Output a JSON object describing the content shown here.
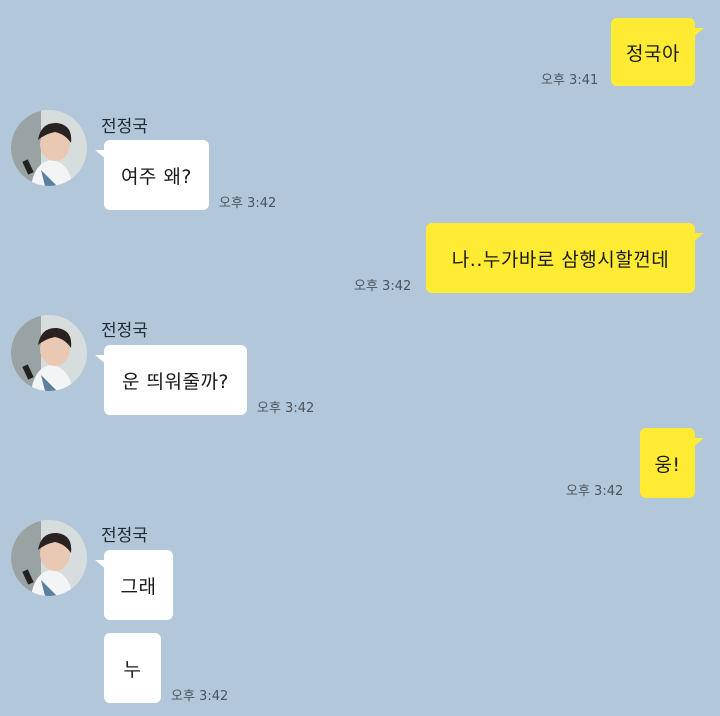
{
  "chat": {
    "sender_name": "전정국",
    "messages": [
      {
        "from": "me",
        "text": "정국아",
        "time": "오후 3:41"
      },
      {
        "from": "other",
        "text": "여주 왜?",
        "time": "오후 3:42"
      },
      {
        "from": "me",
        "text": "나..누가바로 삼행시할껀데",
        "time": "오후 3:42"
      },
      {
        "from": "other",
        "text": "운 띄워줄까?",
        "time": "오후 3:42"
      },
      {
        "from": "me",
        "text": "웅!",
        "time": "오후 3:42"
      },
      {
        "from": "other",
        "text": "그래",
        "time": ""
      },
      {
        "from": "other",
        "text": "누",
        "time": "오후 3:42"
      }
    ]
  },
  "colors": {
    "background": "#b2c7da",
    "my_bubble": "#ffeb33",
    "other_bubble": "#ffffff"
  }
}
